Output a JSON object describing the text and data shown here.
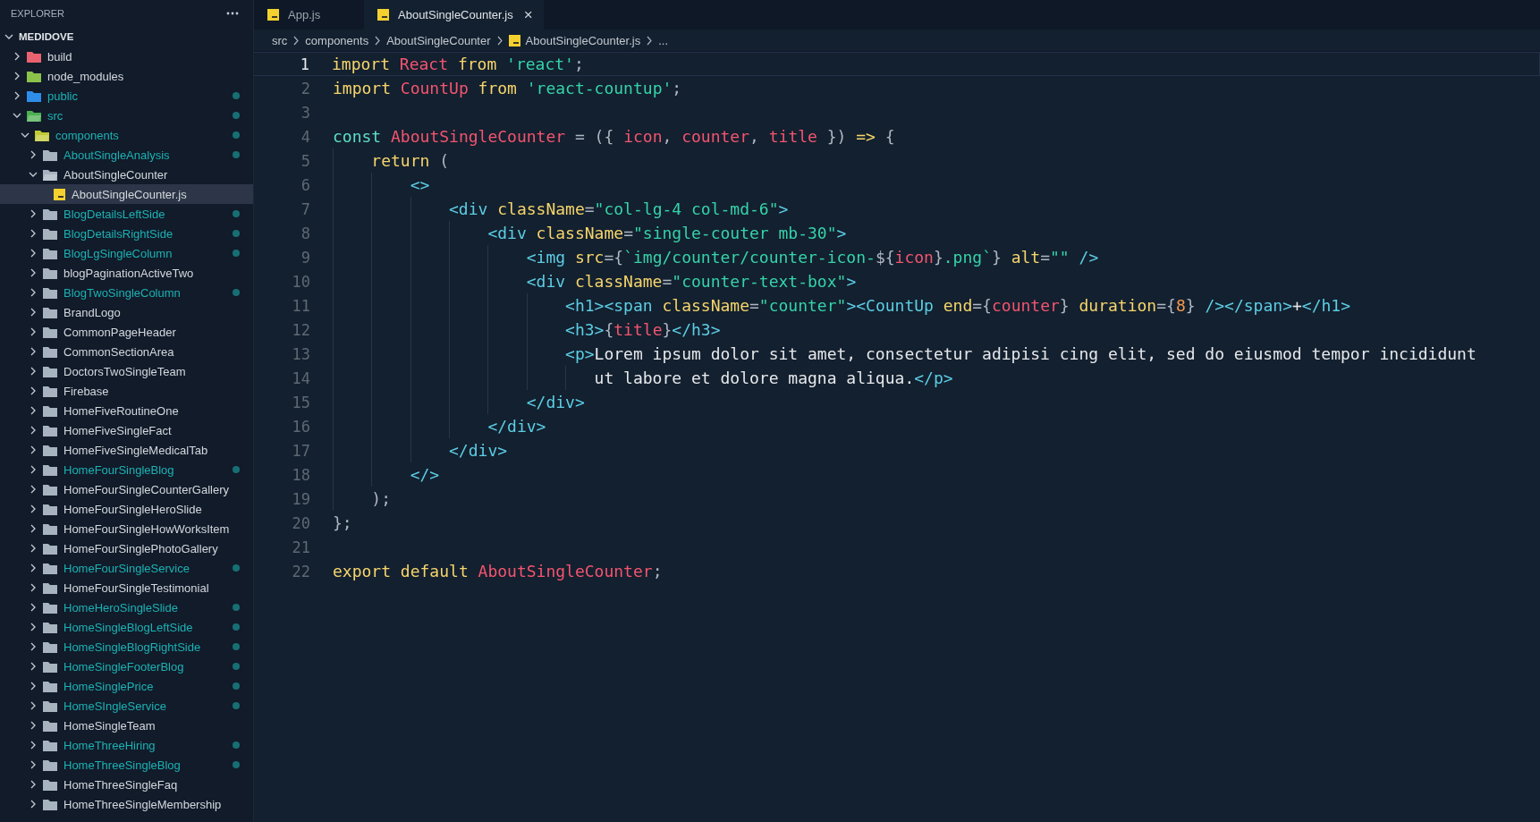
{
  "sidebar": {
    "title": "EXPLORER",
    "tree": [
      {
        "name": "MEDIDOVE",
        "kind": "root",
        "expanded": true,
        "modified": false,
        "selected": false,
        "children": [
          {
            "name": "build",
            "kind": "folder-build",
            "expanded": false,
            "modified": false,
            "selected": false
          },
          {
            "name": "node_modules",
            "kind": "folder-node",
            "expanded": false,
            "modified": false,
            "selected": false
          },
          {
            "name": "public",
            "kind": "folder-public",
            "expanded": false,
            "modified": true,
            "selected": false
          },
          {
            "name": "src",
            "kind": "folder-src",
            "expanded": true,
            "modified": true,
            "selected": false,
            "children": [
              {
                "name": "components",
                "kind": "folder-components",
                "expanded": true,
                "modified": true,
                "selected": false,
                "children": [
                  {
                    "name": "AboutSingleAnalysis",
                    "kind": "folder",
                    "expanded": false,
                    "modified": true,
                    "selected": false
                  },
                  {
                    "name": "AboutSingleCounter",
                    "kind": "folder",
                    "expanded": true,
                    "modified": false,
                    "selected": false,
                    "children": [
                      {
                        "name": "AboutSingleCounter.js",
                        "kind": "file-js",
                        "modified": false,
                        "selected": true
                      }
                    ]
                  },
                  {
                    "name": "BlogDetailsLeftSide",
                    "kind": "folder",
                    "expanded": false,
                    "modified": true,
                    "selected": false
                  },
                  {
                    "name": "BlogDetailsRightSide",
                    "kind": "folder",
                    "expanded": false,
                    "modified": true,
                    "selected": false
                  },
                  {
                    "name": "BlogLgSingleColumn",
                    "kind": "folder",
                    "expanded": false,
                    "modified": true,
                    "selected": false
                  },
                  {
                    "name": "blogPaginationActiveTwo",
                    "kind": "folder",
                    "expanded": false,
                    "modified": false,
                    "selected": false
                  },
                  {
                    "name": "BlogTwoSingleColumn",
                    "kind": "folder",
                    "expanded": false,
                    "modified": true,
                    "selected": false
                  },
                  {
                    "name": "BrandLogo",
                    "kind": "folder",
                    "expanded": false,
                    "modified": false,
                    "selected": false
                  },
                  {
                    "name": "CommonPageHeader",
                    "kind": "folder",
                    "expanded": false,
                    "modified": false,
                    "selected": false
                  },
                  {
                    "name": "CommonSectionArea",
                    "kind": "folder",
                    "expanded": false,
                    "modified": false,
                    "selected": false
                  },
                  {
                    "name": "DoctorsTwoSingleTeam",
                    "kind": "folder",
                    "expanded": false,
                    "modified": false,
                    "selected": false
                  },
                  {
                    "name": "Firebase",
                    "kind": "folder",
                    "expanded": false,
                    "modified": false,
                    "selected": false
                  },
                  {
                    "name": "HomeFiveRoutineOne",
                    "kind": "folder",
                    "expanded": false,
                    "modified": false,
                    "selected": false
                  },
                  {
                    "name": "HomeFiveSingleFact",
                    "kind": "folder",
                    "expanded": false,
                    "modified": false,
                    "selected": false
                  },
                  {
                    "name": "HomeFiveSingleMedicalTab",
                    "kind": "folder",
                    "expanded": false,
                    "modified": false,
                    "selected": false
                  },
                  {
                    "name": "HomeFourSingleBlog",
                    "kind": "folder",
                    "expanded": false,
                    "modified": true,
                    "selected": false
                  },
                  {
                    "name": "HomeFourSingleCounterGallery",
                    "kind": "folder",
                    "expanded": false,
                    "modified": false,
                    "selected": false
                  },
                  {
                    "name": "HomeFourSingleHeroSlide",
                    "kind": "folder",
                    "expanded": false,
                    "modified": false,
                    "selected": false
                  },
                  {
                    "name": "HomeFourSingleHowWorksItem",
                    "kind": "folder",
                    "expanded": false,
                    "modified": false,
                    "selected": false
                  },
                  {
                    "name": "HomeFourSinglePhotoGallery",
                    "kind": "folder",
                    "expanded": false,
                    "modified": false,
                    "selected": false
                  },
                  {
                    "name": "HomeFourSingleService",
                    "kind": "folder",
                    "expanded": false,
                    "modified": true,
                    "selected": false
                  },
                  {
                    "name": "HomeFourSingleTestimonial",
                    "kind": "folder",
                    "expanded": false,
                    "modified": false,
                    "selected": false
                  },
                  {
                    "name": "HomeHeroSingleSlide",
                    "kind": "folder",
                    "expanded": false,
                    "modified": true,
                    "selected": false
                  },
                  {
                    "name": "HomeSingleBlogLeftSide",
                    "kind": "folder",
                    "expanded": false,
                    "modified": true,
                    "selected": false
                  },
                  {
                    "name": "HomeSingleBlogRightSide",
                    "kind": "folder",
                    "expanded": false,
                    "modified": true,
                    "selected": false
                  },
                  {
                    "name": "HomeSingleFooterBlog",
                    "kind": "folder",
                    "expanded": false,
                    "modified": true,
                    "selected": false
                  },
                  {
                    "name": "HomeSinglePrice",
                    "kind": "folder",
                    "expanded": false,
                    "modified": true,
                    "selected": false
                  },
                  {
                    "name": "HomeSIngleService",
                    "kind": "folder",
                    "expanded": false,
                    "modified": true,
                    "selected": false
                  },
                  {
                    "name": "HomeSingleTeam",
                    "kind": "folder",
                    "expanded": false,
                    "modified": false,
                    "selected": false
                  },
                  {
                    "name": "HomeThreeHiring",
                    "kind": "folder",
                    "expanded": false,
                    "modified": true,
                    "selected": false
                  },
                  {
                    "name": "HomeThreeSingleBlog",
                    "kind": "folder",
                    "expanded": false,
                    "modified": true,
                    "selected": false
                  },
                  {
                    "name": "HomeThreeSingleFaq",
                    "kind": "folder",
                    "expanded": false,
                    "modified": false,
                    "selected": false
                  },
                  {
                    "name": "HomeThreeSingleMembership",
                    "kind": "folder",
                    "expanded": false,
                    "modified": false,
                    "selected": false
                  }
                ]
              }
            ]
          }
        ]
      }
    ]
  },
  "tabs": [
    {
      "label": "App.js",
      "selected": false
    },
    {
      "label": "AboutSingleCounter.js",
      "selected": true,
      "close": "×"
    }
  ],
  "breadcrumb": [
    {
      "label": "src",
      "kind": "folder"
    },
    {
      "label": "components",
      "kind": "folder"
    },
    {
      "label": "AboutSingleCounter",
      "kind": "folder"
    },
    {
      "label": "AboutSingleCounter.js",
      "kind": "file-js"
    },
    {
      "label": "...",
      "kind": "more"
    }
  ],
  "code": [
    {
      "number": "1",
      "active": true,
      "tokens": [
        {
          "kind": "kw",
          "text": "import "
        },
        {
          "kind": "var",
          "text": "React "
        },
        {
          "kind": "kw",
          "text": "from "
        },
        {
          "kind": "str",
          "text": "'react'"
        },
        {
          "kind": "punct",
          "text": ";"
        }
      ]
    },
    {
      "number": "2",
      "active": false,
      "tokens": [
        {
          "kind": "kw",
          "text": "import "
        },
        {
          "kind": "var",
          "text": "CountUp "
        },
        {
          "kind": "kw",
          "text": "from "
        },
        {
          "kind": "str",
          "text": "'react-countup'"
        },
        {
          "kind": "punct",
          "text": ";"
        }
      ]
    },
    {
      "number": "3",
      "active": false
    },
    {
      "number": "4",
      "active": false,
      "tokens": [
        {
          "kind": "kw2",
          "text": "const "
        },
        {
          "kind": "var",
          "text": "AboutSingleCounter "
        },
        {
          "kind": "punct",
          "text": "= ({ "
        },
        {
          "kind": "var",
          "text": "icon"
        },
        {
          "kind": "punct",
          "text": ", "
        },
        {
          "kind": "var",
          "text": "counter"
        },
        {
          "kind": "punct",
          "text": ", "
        },
        {
          "kind": "var",
          "text": "title"
        },
        {
          "kind": "punct",
          "text": " }) "
        },
        {
          "kind": "kw",
          "text": "=> "
        },
        {
          "kind": "punct",
          "text": "{"
        }
      ],
      "children": [
        {
          "number": "5",
          "active": false,
          "tokens": [
            {
              "kind": "kw",
              "text": "return "
            },
            {
              "kind": "punct",
              "text": "("
            }
          ],
          "children": [
            {
              "number": "6",
              "active": false,
              "tokens": [
                {
                  "kind": "tag",
                  "text": "<>"
                }
              ],
              "children": [
                {
                  "number": "7",
                  "active": false,
                  "tokens": [
                    {
                      "kind": "tag",
                      "text": "<div "
                    },
                    {
                      "kind": "attr",
                      "text": "className"
                    },
                    {
                      "kind": "punct",
                      "text": "="
                    },
                    {
                      "kind": "str",
                      "text": "\"col-lg-4 col-md-6\""
                    },
                    {
                      "kind": "tag",
                      "text": ">"
                    }
                  ],
                  "children": [
                    {
                      "number": "8",
                      "active": false,
                      "tokens": [
                        {
                          "kind": "tag",
                          "text": "<div "
                        },
                        {
                          "kind": "attr",
                          "text": "className"
                        },
                        {
                          "kind": "punct",
                          "text": "="
                        },
                        {
                          "kind": "str",
                          "text": "\"single-couter mb-30\""
                        },
                        {
                          "kind": "tag",
                          "text": ">"
                        }
                      ],
                      "children": [
                        {
                          "number": "9",
                          "active": false,
                          "tokens": [
                            {
                              "kind": "tag",
                              "text": "<img "
                            },
                            {
                              "kind": "attr",
                              "text": "src"
                            },
                            {
                              "kind": "punct",
                              "text": "={"
                            },
                            {
                              "kind": "str",
                              "text": "`img/counter/counter-icon-"
                            },
                            {
                              "kind": "punct",
                              "text": "${"
                            },
                            {
                              "kind": "var",
                              "text": "icon"
                            },
                            {
                              "kind": "punct",
                              "text": "}"
                            },
                            {
                              "kind": "str",
                              "text": ".png`"
                            },
                            {
                              "kind": "punct",
                              "text": "} "
                            },
                            {
                              "kind": "attr",
                              "text": "alt"
                            },
                            {
                              "kind": "punct",
                              "text": "="
                            },
                            {
                              "kind": "str",
                              "text": "\"\""
                            },
                            {
                              "kind": "tag",
                              "text": " />"
                            }
                          ]
                        },
                        {
                          "number": "10",
                          "active": false,
                          "tokens": [
                            {
                              "kind": "tag",
                              "text": "<div "
                            },
                            {
                              "kind": "attr",
                              "text": "className"
                            },
                            {
                              "kind": "punct",
                              "text": "="
                            },
                            {
                              "kind": "str",
                              "text": "\"counter-text-box\""
                            },
                            {
                              "kind": "tag",
                              "text": ">"
                            }
                          ],
                          "children": [
                            {
                              "number": "11",
                              "active": false,
                              "tokens": [
                                {
                                  "kind": "tag",
                                  "text": "<h1><span "
                                },
                                {
                                  "kind": "attr",
                                  "text": "className"
                                },
                                {
                                  "kind": "punct",
                                  "text": "="
                                },
                                {
                                  "kind": "str",
                                  "text": "\"counter\""
                                },
                                {
                                  "kind": "tag",
                                  "text": "><CountUp "
                                },
                                {
                                  "kind": "attr",
                                  "text": "end"
                                },
                                {
                                  "kind": "punct",
                                  "text": "={"
                                },
                                {
                                  "kind": "var",
                                  "text": "counter"
                                },
                                {
                                  "kind": "punct",
                                  "text": "} "
                                },
                                {
                                  "kind": "attr",
                                  "text": "duration"
                                },
                                {
                                  "kind": "punct",
                                  "text": "={"
                                },
                                {
                                  "kind": "num",
                                  "text": "8"
                                },
                                {
                                  "kind": "punct",
                                  "text": "} "
                                },
                                {
                                  "kind": "tag",
                                  "text": "/></span>"
                                },
                                {
                                  "kind": "plain",
                                  "text": "+"
                                },
                                {
                                  "kind": "tag",
                                  "text": "</h1>"
                                }
                              ]
                            },
                            {
                              "number": "12",
                              "active": false,
                              "tokens": [
                                {
                                  "kind": "tag",
                                  "text": "<h3>"
                                },
                                {
                                  "kind": "punct",
                                  "text": "{"
                                },
                                {
                                  "kind": "var",
                                  "text": "title"
                                },
                                {
                                  "kind": "punct",
                                  "text": "}"
                                },
                                {
                                  "kind": "tag",
                                  "text": "</h3>"
                                }
                              ]
                            },
                            {
                              "number": "13",
                              "active": false,
                              "tokens": [
                                {
                                  "kind": "tag",
                                  "text": "<p>"
                                },
                                {
                                  "kind": "plain",
                                  "text": "Lorem ipsum dolor sit amet, consectetur adipisi cing elit, sed do eiusmod tempor incididunt"
                                }
                              ],
                              "children": [
                                {
                                  "number": "14",
                                  "active": false,
                                  "wrap": true,
                                  "tokens": [
                                    {
                                      "kind": "plain",
                                      "text": "ut labore et dolore magna aliqua."
                                    },
                                    {
                                      "kind": "tag",
                                      "text": "</p>"
                                    }
                                  ]
                                }
                              ]
                            }
                          ]
                        },
                        {
                          "number": "15",
                          "active": false,
                          "tokens": [
                            {
                              "kind": "tag",
                              "text": "</div>"
                            }
                          ]
                        }
                      ]
                    },
                    {
                      "number": "16",
                      "active": false,
                      "tokens": [
                        {
                          "kind": "tag",
                          "text": "</div>"
                        }
                      ]
                    }
                  ]
                },
                {
                  "number": "17",
                  "active": false,
                  "tokens": [
                    {
                      "kind": "tag",
                      "text": "</div>"
                    }
                  ]
                }
              ]
            },
            {
              "number": "18",
              "active": false,
              "tokens": [
                {
                  "kind": "tag",
                  "text": "</>"
                }
              ]
            }
          ]
        },
        {
          "number": "19",
          "active": false,
          "tokens": [
            {
              "kind": "punct",
              "text": ");"
            }
          ]
        }
      ]
    },
    {
      "number": "20",
      "active": false,
      "tokens": [
        {
          "kind": "punct",
          "text": "};"
        }
      ]
    },
    {
      "number": "21",
      "active": false
    },
    {
      "number": "22",
      "active": false,
      "tokens": [
        {
          "kind": "kw",
          "text": "export default "
        },
        {
          "kind": "var",
          "text": "AboutSingleCounter"
        },
        {
          "kind": "punct",
          "text": ";"
        }
      ]
    }
  ]
}
